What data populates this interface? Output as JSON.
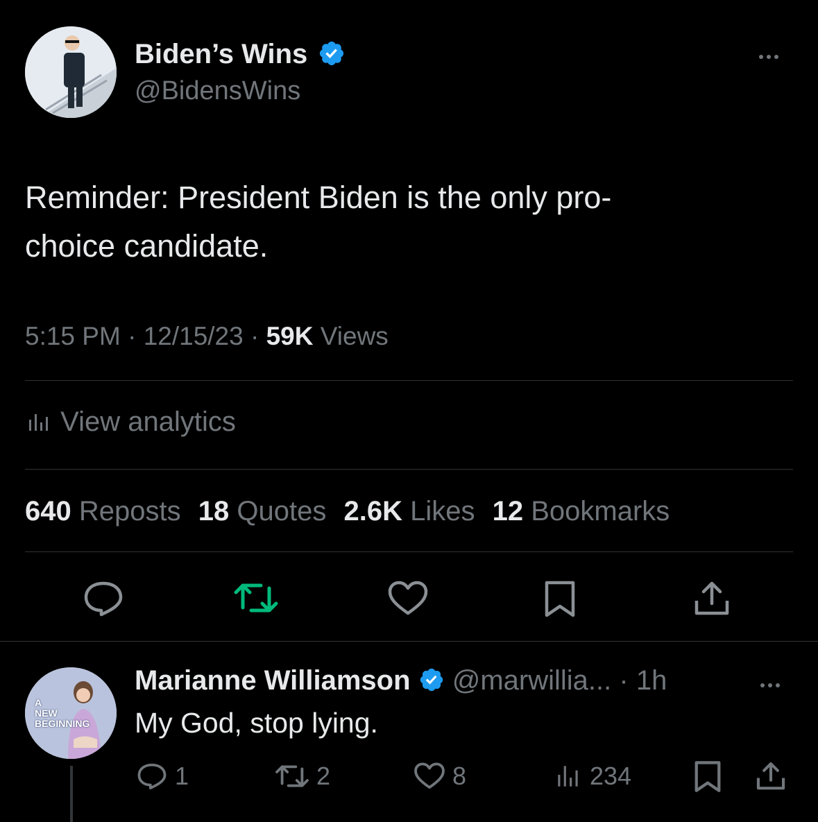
{
  "tweet": {
    "author_name": "Biden’s Wins",
    "author_handle": "@BidensWins",
    "text_line1": "Reminder: President Biden is the only pro-",
    "text_line2": "choice candidate.",
    "time": "5:15 PM",
    "date": "12/15/23",
    "views_count": "59K",
    "views_label": "Views",
    "analytics_label": "View analytics",
    "stats": {
      "reposts_count": "640",
      "reposts_label": "Reposts",
      "quotes_count": "18",
      "quotes_label": "Quotes",
      "likes_count": "2.6K",
      "likes_label": "Likes",
      "bookmarks_count": "12",
      "bookmarks_label": "Bookmarks"
    }
  },
  "reply": {
    "author_name": "Marianne Williamson",
    "author_handle": "@marwillia...",
    "time": "1h",
    "text": "My God, stop lying.",
    "avatar_text": {
      "line1": "A",
      "line2": "NEW",
      "line3": "BEGINNING"
    },
    "replies": "1",
    "reposts": "2",
    "likes": "8",
    "views": "234"
  },
  "colors": {
    "background": "#000000",
    "text_primary": "#e7e9ea",
    "text_muted": "#71767b",
    "verified": "#1d9bf0",
    "repost_active": "#00ba7c",
    "divider": "#2f3336"
  },
  "icons": [
    "verified-badge-icon",
    "more-icon",
    "analytics-icon",
    "reply-icon",
    "repost-icon",
    "like-icon",
    "bookmark-icon",
    "share-icon"
  ]
}
